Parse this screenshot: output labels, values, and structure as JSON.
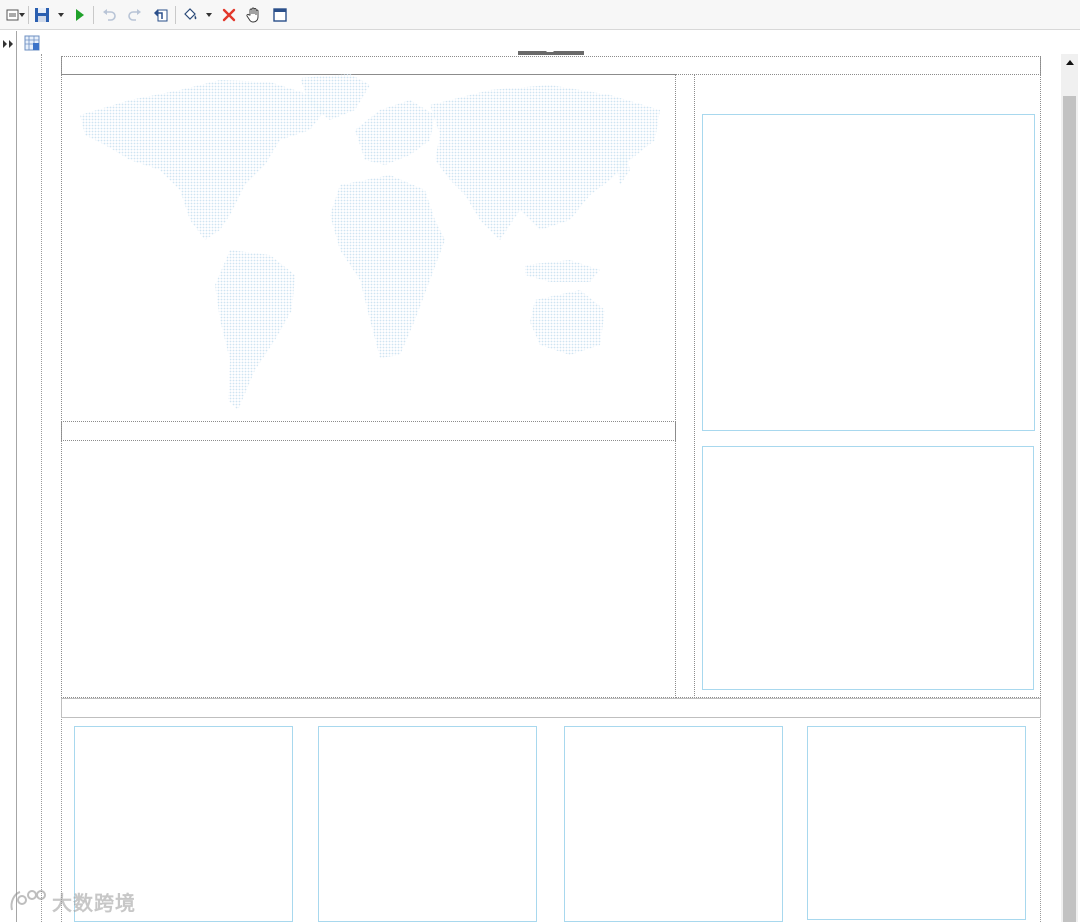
{
  "toolbar": {
    "buttons": [
      {
        "name": "page-setup-icon"
      },
      {
        "name": "save-icon"
      },
      {
        "name": "run-icon"
      },
      {
        "name": "undo-icon"
      },
      {
        "name": "redo-icon"
      },
      {
        "name": "back-icon"
      },
      {
        "name": "paint-bucket-icon"
      },
      {
        "name": "delete-icon"
      },
      {
        "name": "pan-hand-icon"
      },
      {
        "name": "window-icon"
      }
    ],
    "colors": {
      "run": "#1fa12a",
      "delete": "#e2372a",
      "save": "#2a5fb0",
      "disabled": "#b8c4d6"
    }
  },
  "canvas": {
    "chart_border_color": "#a8d8ee",
    "map_dot_color": "#cfe4f2"
  },
  "watermark": {
    "text": "大数跨境",
    "icon": "dapx-logo-icon"
  }
}
